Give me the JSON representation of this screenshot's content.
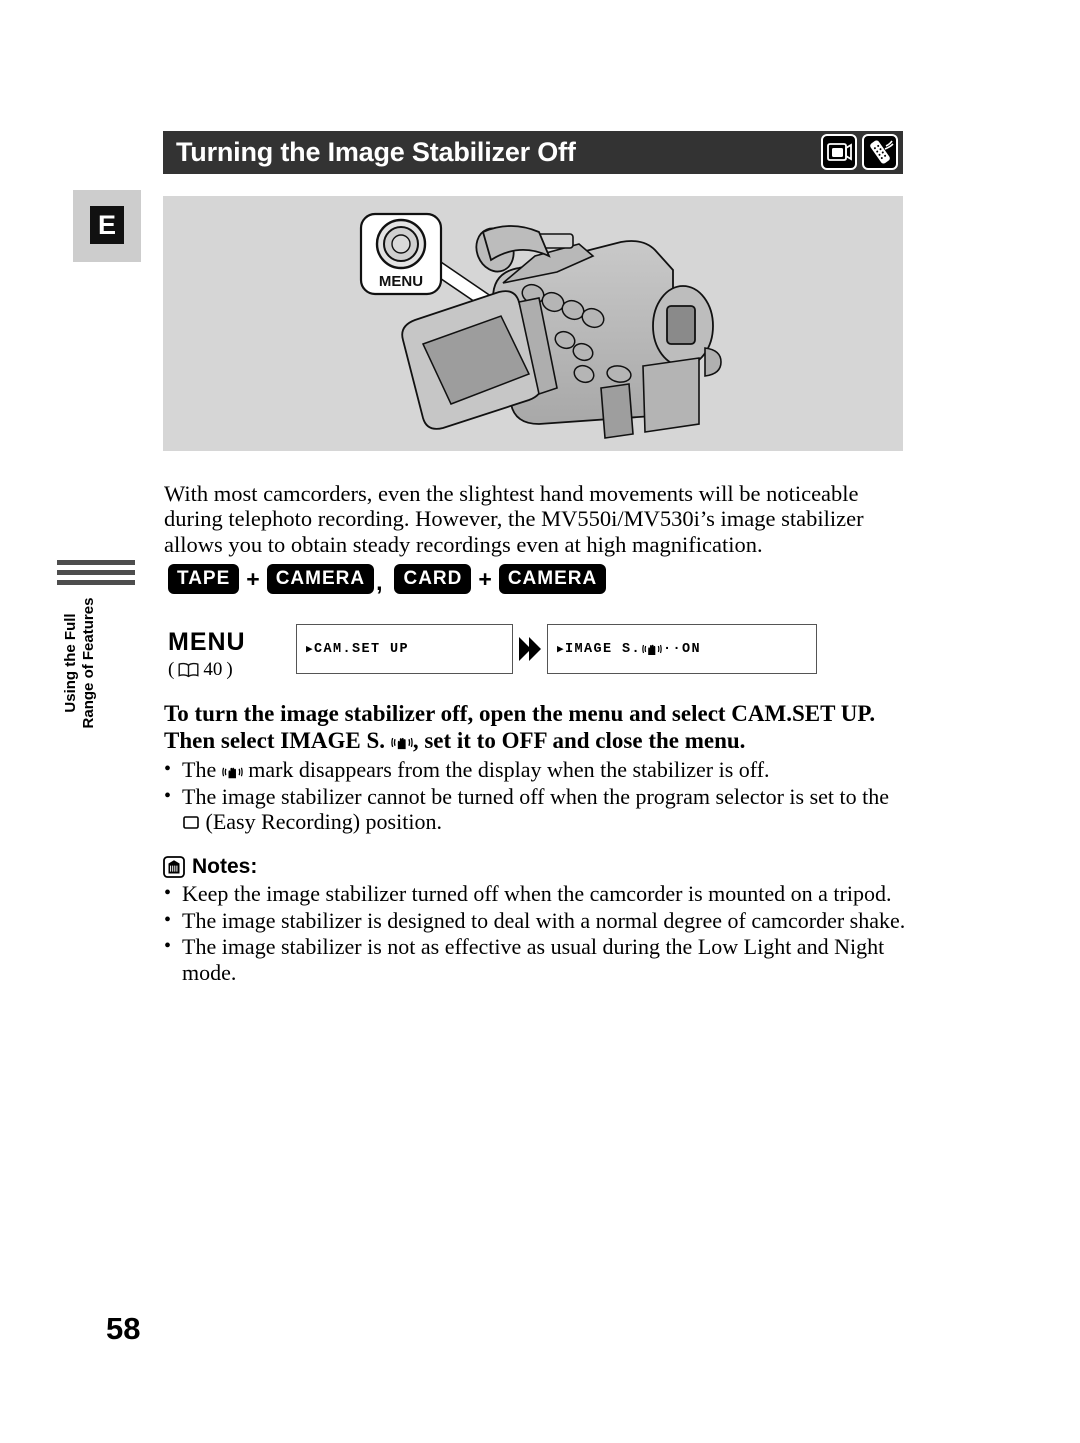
{
  "header": {
    "title": "Turning the Image Stabilizer Off",
    "icons": [
      {
        "name": "camcorder-lcd-icon",
        "label": "camcorder"
      },
      {
        "name": "remote-control-icon",
        "label": "remote"
      }
    ]
  },
  "sidebar": {
    "language_tab": "E",
    "chapter_label": "Using the Full\nRange of Features"
  },
  "illustration": {
    "callout_label": "MENU",
    "alt": "camcorder with open LCD panel and MENU button callout"
  },
  "intro_paragraph": "With most camcorders, even the slightest hand movements will be noticeable during telephoto recording. However, the MV550i/MV530i’s image stabilizer allows you to obtain steady recordings even at high magnification.",
  "mode_badges": {
    "group1": {
      "mode": "TAPE",
      "operator": "+",
      "submode": "CAMERA"
    },
    "separator": ",",
    "group2": {
      "mode": "CARD",
      "operator": "+",
      "submode": "CAMERA"
    }
  },
  "menu_flow": {
    "menu_word": "MENU",
    "reference_open": "(",
    "reference_page": "40",
    "reference_close": ")",
    "step1": {
      "marker": "▶",
      "text": "CAM.SET UP"
    },
    "step2": {
      "marker": "▶",
      "prefix": "IMAGE S.",
      "icon": "stabilizer-hand-icon",
      "suffix": "··ON"
    }
  },
  "instruction": {
    "part1": "To turn the image stabilizer off, open the menu and select CAM.SET UP. Then select IMAGE S. ",
    "icon": "stabilizer-hand-icon",
    "part2": ", set it to OFF and close the menu."
  },
  "main_bullets": [
    {
      "marker": "•",
      "part1": "The ",
      "icon": "stabilizer-hand-icon",
      "part2": " mark disappears from the display when the stabilizer is off."
    },
    {
      "marker": "•",
      "part1": "The image stabilizer cannot be turned off when the program selector is set to the ",
      "icon": "easy-recording-square-icon",
      "part2": " (Easy Recording) position."
    }
  ],
  "notes": {
    "icon": "note-memo-icon",
    "heading": "Notes:",
    "items": [
      {
        "marker": "•",
        "text": "Keep the image stabilizer turned off when the camcorder is mounted on a tripod."
      },
      {
        "marker": "•",
        "text": "The image stabilizer is designed to deal with a normal degree of camcorder shake."
      },
      {
        "marker": "•",
        "text": "The image stabilizer is not as effective as usual during the Low Light and Night mode."
      }
    ]
  },
  "page_number": "58",
  "colors": {
    "header_bar": "#333333",
    "illustration_panel": "#d6d6d6",
    "tab_background": "#cdcdcd",
    "badge_background": "#000000"
  }
}
